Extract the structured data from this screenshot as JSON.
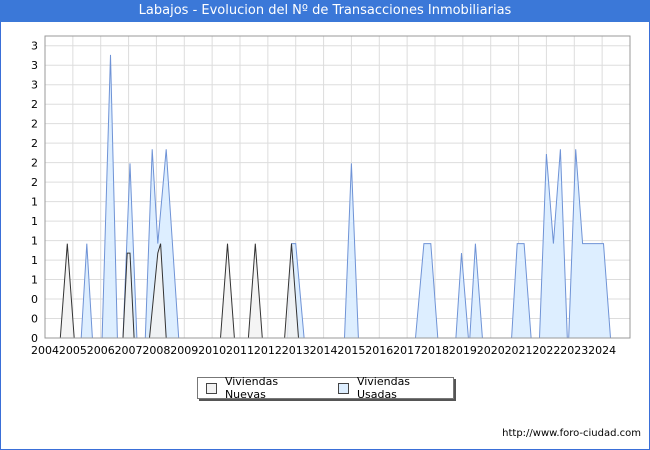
{
  "title": "Labajos - Evolucion del Nº de Transacciones Inmobiliarias",
  "footer": "http://www.foro-ciudad.com",
  "chart_data": {
    "type": "area",
    "x_ticks": [
      "2004",
      "2005",
      "2006",
      "2007",
      "2008",
      "2009",
      "2010",
      "2011",
      "2012",
      "2013",
      "2014",
      "2015",
      "2016",
      "2017",
      "2018",
      "2019",
      "2020",
      "2021",
      "2022",
      "2023",
      "2024"
    ],
    "y_tick_labels": [
      "0",
      "0",
      "0",
      "1",
      "1",
      "1",
      "1",
      "1",
      "2",
      "2",
      "2",
      "2",
      "2",
      "3",
      "3",
      "3"
    ],
    "ylim": [
      0,
      3.2
    ],
    "xlim": [
      2004,
      2025
    ],
    "grid": true,
    "legend_position": "bottom",
    "series": [
      {
        "name": "Viviendas Nuevas",
        "fill": "#f2f2f2",
        "stroke": "#333333",
        "points": [
          [
            2004.55,
            0
          ],
          [
            2004.8,
            1
          ],
          [
            2005.05,
            0
          ],
          [
            2006.8,
            0
          ],
          [
            2006.95,
            0.9
          ],
          [
            2007.05,
            0.9
          ],
          [
            2007.2,
            0
          ],
          [
            2007.75,
            0
          ],
          [
            2008.05,
            0.9
          ],
          [
            2008.15,
            1
          ],
          [
            2008.35,
            0
          ],
          [
            2010.3,
            0
          ],
          [
            2010.55,
            1
          ],
          [
            2010.8,
            0
          ],
          [
            2011.3,
            0
          ],
          [
            2011.55,
            1
          ],
          [
            2011.8,
            0
          ],
          [
            2012.6,
            0
          ],
          [
            2012.85,
            1
          ],
          [
            2013.1,
            0
          ]
        ]
      },
      {
        "name": "Viviendas Usadas",
        "fill": "#ddeeff",
        "stroke": "#6f93d6",
        "points": [
          [
            2005.3,
            0
          ],
          [
            2005.5,
            1
          ],
          [
            2005.7,
            0
          ],
          [
            2006.05,
            0
          ],
          [
            2006.35,
            3
          ],
          [
            2006.6,
            0
          ],
          [
            2006.8,
            0
          ],
          [
            2007.05,
            1.85
          ],
          [
            2007.3,
            0
          ],
          [
            2007.6,
            0
          ],
          [
            2007.85,
            2
          ],
          [
            2008.05,
            1
          ],
          [
            2008.35,
            2
          ],
          [
            2008.8,
            0
          ],
          [
            2012.7,
            0
          ],
          [
            2012.85,
            1
          ],
          [
            2013.0,
            1
          ],
          [
            2013.3,
            0
          ],
          [
            2014.75,
            0
          ],
          [
            2015.0,
            1.85
          ],
          [
            2015.25,
            0
          ],
          [
            2017.3,
            0
          ],
          [
            2017.6,
            1
          ],
          [
            2017.85,
            1
          ],
          [
            2018.1,
            0
          ],
          [
            2018.75,
            0
          ],
          [
            2018.95,
            0.9
          ],
          [
            2019.2,
            0
          ],
          [
            2019.25,
            0
          ],
          [
            2019.45,
            1
          ],
          [
            2019.7,
            0
          ],
          [
            2020.75,
            0
          ],
          [
            2020.95,
            1
          ],
          [
            2021.2,
            1
          ],
          [
            2021.45,
            0
          ],
          [
            2021.75,
            0
          ],
          [
            2022.0,
            1.95
          ],
          [
            2022.25,
            1
          ],
          [
            2022.5,
            2
          ],
          [
            2022.75,
            0
          ],
          [
            2022.8,
            0
          ],
          [
            2023.05,
            2
          ],
          [
            2023.3,
            1
          ],
          [
            2023.55,
            1
          ],
          [
            2023.8,
            1
          ],
          [
            2024.05,
            1
          ],
          [
            2024.3,
            0
          ]
        ]
      }
    ]
  }
}
